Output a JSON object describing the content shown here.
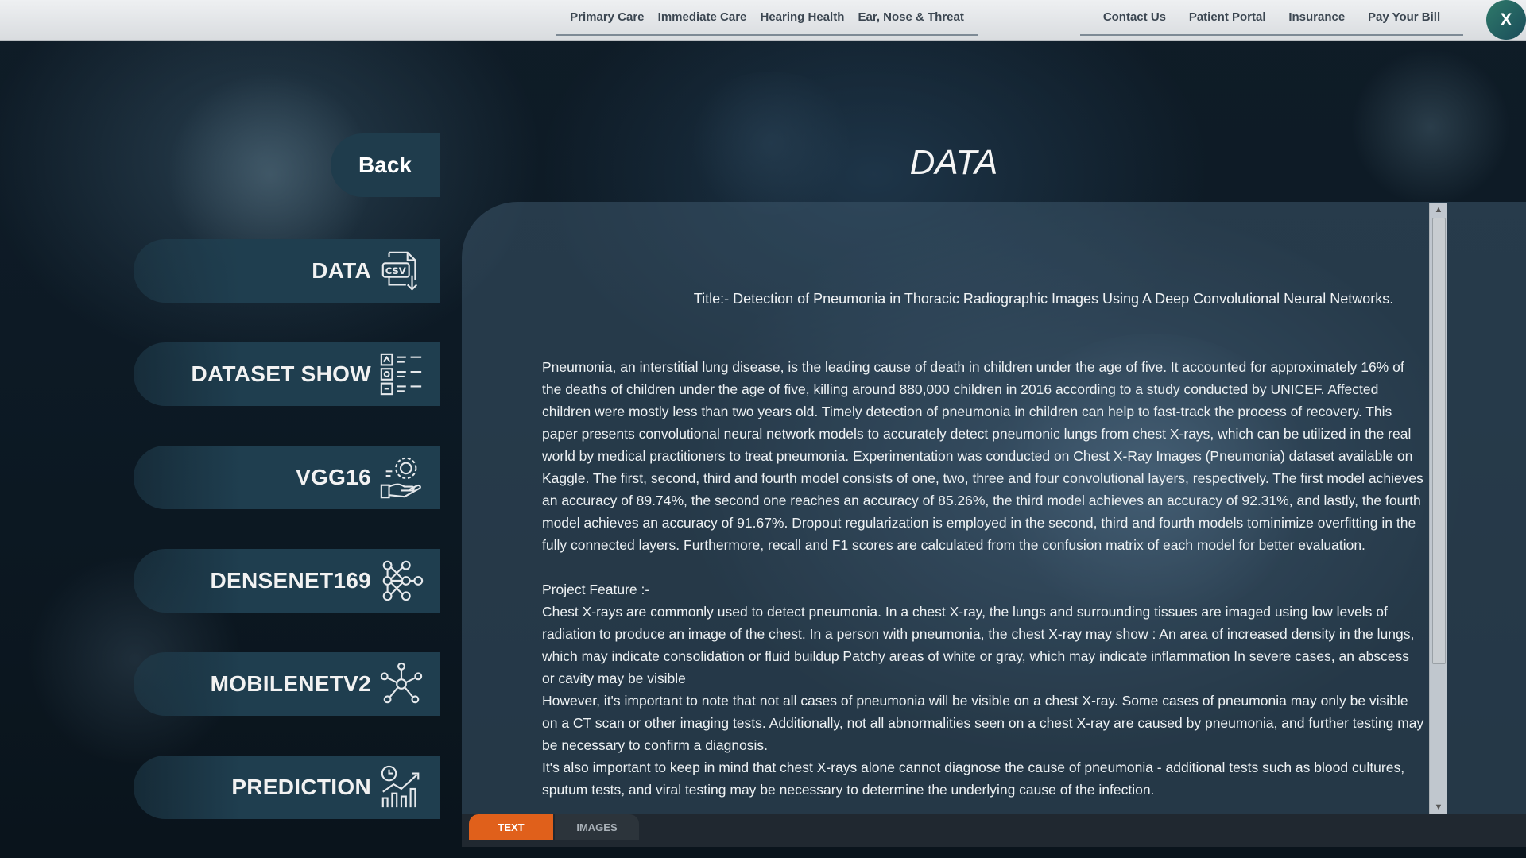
{
  "topnav": {
    "left_links": [
      "Primary Care",
      "Immediate Care",
      "Hearing Health",
      "Ear, Nose & Threat"
    ],
    "right_links": [
      "Contact Us",
      "Patient Portal",
      "Insurance",
      "Pay Your Bill"
    ],
    "close_label": "X"
  },
  "sidebar": {
    "back_label": "Back",
    "items": [
      {
        "label": "DATA",
        "icon": "csv-file-icon"
      },
      {
        "label": "DATASET SHOW",
        "icon": "list-checklist-icon"
      },
      {
        "label": "VGG16",
        "icon": "hand-gear-icon"
      },
      {
        "label": "DENSENET169",
        "icon": "network-nodes-icon"
      },
      {
        "label": "MOBILENETV2",
        "icon": "hub-nodes-icon"
      },
      {
        "label": "PREDICTION",
        "icon": "chart-growth-icon"
      }
    ]
  },
  "page": {
    "title": "DATA"
  },
  "document": {
    "title": "Title:- Detection of Pneumonia in Thoracic Radiographic Images Using A Deep Convolutional Neural Networks.",
    "abstract": "Pneumonia, an interstitial lung disease, is the leading cause of death in children under the age of five. It accounted for approximately 16% of the deaths of children under the age of five, killing around 880,000 children in 2016 according to a study conducted by UNICEF. Affected children were mostly less than two years old. Timely detection of pneumonia in children can help to fast-track the process of recovery. This paper presents convolutional neural network models to accurately detect pneumonic lungs from chest X-rays, which can be utilized in the real world by medical practitioners to treat pneumonia. Experimentation was conducted on Chest X-Ray Images (Pneumonia) dataset available on Kaggle. The first, second, third and fourth model consists of one, two, three and four convolutional layers, respectively. The first model achieves an accuracy of 89.74%, the second one reaches an accuracy of 85.26%, the third model achieves an accuracy of 92.31%, and lastly, the fourth model achieves an accuracy of 91.67%. Dropout regularization is employed in the second, third and fourth models tominimize overfitting in the fully connected layers. Furthermore, recall and F1 scores are calculated from the confusion matrix of each model for better evaluation.",
    "feature_heading": "Project Feature :-",
    "feature_p1": "Chest X-rays are commonly used to detect pneumonia. In a chest X-ray, the lungs and surrounding tissues are imaged using low levels of radiation to produce an image of the chest. In a person with pneumonia, the chest X-ray may show : An area of increased density in the lungs, which may indicate consolidation or fluid buildup Patchy areas of white or gray, which may indicate inflammation In severe cases, an abscess or cavity may be visible",
    "feature_p2": "However, it's important to note that not all cases of pneumonia will be visible on a chest X-ray. Some cases of pneumonia may only be visible on a CT scan or other imaging tests. Additionally, not all abnormalities seen on a chest X-ray are caused by pneumonia, and further testing may be necessary to confirm a diagnosis.",
    "feature_p3": "It's also important to keep in mind that chest X-rays alone cannot diagnose the cause of pneumonia - additional tests such as blood cultures, sputum tests, and viral testing may be necessary to determine the underlying cause of the infection."
  },
  "tabs": [
    {
      "label": "TEXT",
      "active": true
    },
    {
      "label": "IMAGES",
      "active": false
    }
  ],
  "colors": {
    "accent": "#e0601b",
    "button_bg": "#1f3e4f"
  }
}
